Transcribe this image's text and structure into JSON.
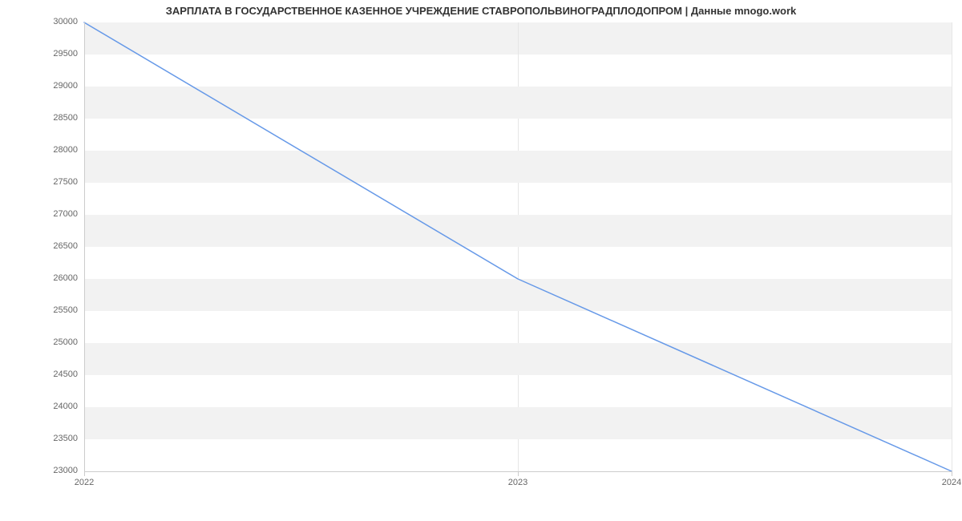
{
  "chart_data": {
    "type": "line",
    "title": "ЗАРПЛАТА В ГОСУДАРСТВЕННОЕ КАЗЕННОЕ УЧРЕЖДЕНИЕ СТАВРОПОЛЬВИНОГРАДПЛОДОПРОМ | Данные mnogo.work",
    "xlabel": "",
    "ylabel": "",
    "x": [
      "2022",
      "2023",
      "2024"
    ],
    "series": [
      {
        "name": "salary",
        "values": [
          30000,
          26000,
          23000
        ],
        "color": "#6699e8"
      }
    ],
    "y_ticks": [
      23000,
      23500,
      24000,
      24500,
      25000,
      25500,
      26000,
      26500,
      27000,
      27500,
      28000,
      28500,
      29000,
      29500,
      30000
    ],
    "x_ticks": [
      "2022",
      "2023",
      "2024"
    ],
    "ylim": [
      23000,
      30000
    ],
    "grid": {
      "horizontal_bands": true,
      "vertical_lines": true
    }
  }
}
